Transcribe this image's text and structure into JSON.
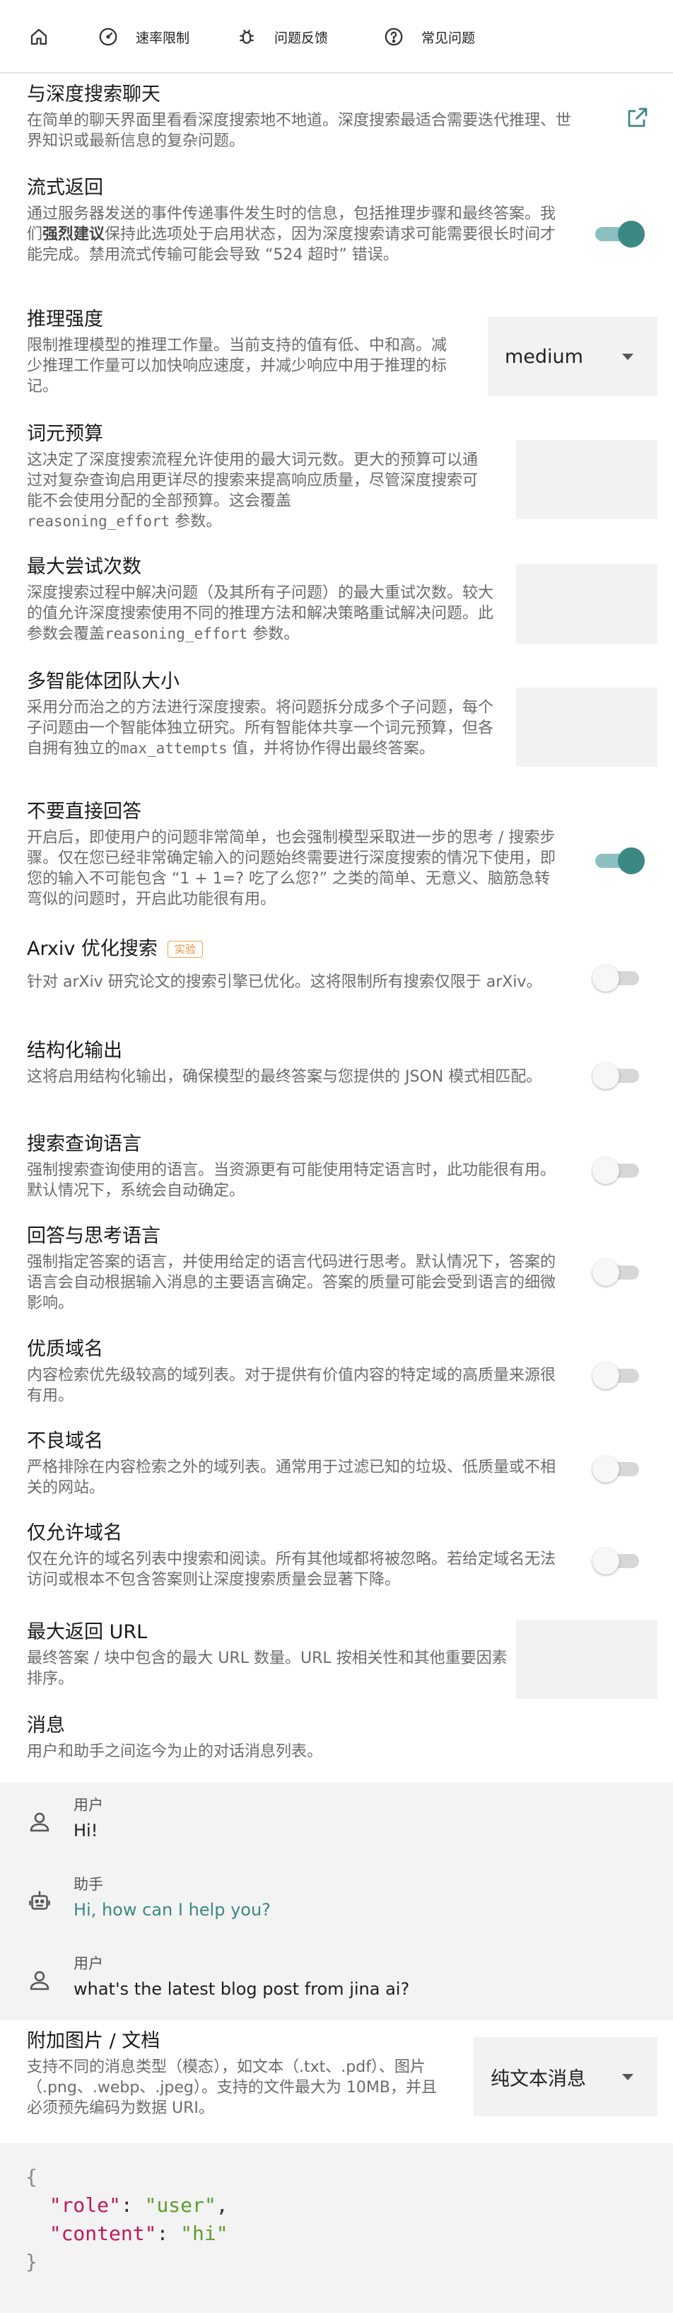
{
  "nav": {
    "home_icon": "home-icon",
    "items": [
      {
        "icon": "speedometer-icon",
        "label": "速率限制"
      },
      {
        "icon": "bug-icon",
        "label": "问题反馈"
      },
      {
        "icon": "help-circle-icon",
        "label": "常见问题"
      }
    ]
  },
  "chat": {
    "title": "与深度搜索聊天",
    "desc": "在简单的聊天界面里看看深度搜索地不地道。深度搜索最适合需要迭代推理、世界知识或最新信息的复杂问题。",
    "icon": "external-link-icon"
  },
  "stream": {
    "title": "流式返回",
    "desc_a": "通过服务器发送的事件传递事件发生时的信息，包括推理步骤和最终答案。我们",
    "desc_bold": "强烈建议",
    "desc_b": "保持此选项处于启用状态，因为深度搜索请求可能需要很长时间才能完成。禁用流式传输可能会导致 “524 超时” 错误。",
    "enabled": true
  },
  "reasoning": {
    "title": "推理强度",
    "desc": "限制推理模型的推理工作量。当前支持的值有低、中和高。减少推理工作量可以加快响应速度，并减少响应中用于推理的标记。",
    "value": "medium"
  },
  "budget": {
    "title": "词元预算",
    "desc": "这决定了深度搜索流程允许使用的最大词元数。更大的预算可以通过对复杂查询启用更详尽的搜索来提高响应质量，尽管深度搜索可能不会使用分配的全部预算。这会覆盖",
    "code": "reasoning_effort",
    "desc_end": " 参数。"
  },
  "attempts": {
    "title": "最大尝试次数",
    "desc": "深度搜索过程中解决问题（及其所有子问题）的最大重试次数。较大的值允许深度搜索使用不同的推理方法和解决策略重试解决问题。此参数会覆盖",
    "code": "reasoning_effort",
    "desc_end": " 参数。"
  },
  "team": {
    "title": "多智能体团队大小",
    "desc": "采用分而治之的方法进行深度搜索。将问题拆分成多个子问题，每个子问题由一个智能体独立研究。所有智能体共享一个词元预算，但各自拥有独立的",
    "code": "max_attempts",
    "desc_end": " 值，并将协作得出最终答案。"
  },
  "no_direct": {
    "title": "不要直接回答",
    "desc": "开启后，即使用户的问题非常简单，也会强制模型采取进一步的思考 / 搜索步骤。仅在您已经非常确定输入的问题始终需要进行深度搜索的情况下使用，即您的输入不可能包含 “1 + 1=? 吃了么您?” 之类的简单、无意义、脑筋急转弯似的问题时，开启此功能很有用。",
    "enabled": true
  },
  "arxiv": {
    "title": "Arxiv 优化搜索",
    "badge": "实验",
    "desc": "针对 arXiv 研究论文的搜索引擎已优化。这将限制所有搜索仅限于 arXiv。",
    "enabled": false
  },
  "structured": {
    "title": "结构化输出",
    "desc": "这将启用结构化输出，确保模型的最终答案与您提供的 JSON 模式相匹配。",
    "enabled": false
  },
  "search_lang": {
    "title": "搜索查询语言",
    "desc": "强制搜索查询使用的语言。当资源更有可能使用特定语言时，此功能很有用。默认情况下，系统会自动确定。",
    "enabled": false
  },
  "answer_lang": {
    "title": "回答与思考语言",
    "desc": "强制指定答案的语言，并使用给定的语言代码进行思考。默认情况下，答案的语言会自动根据输入消息的主要语言确定。答案的质量可能会受到语言的细微影响。",
    "enabled": false
  },
  "good_domains": {
    "title": "优质域名",
    "desc": "内容检索优先级较高的域列表。对于提供有价值内容的特定域的高质量来源很有用。",
    "enabled": false
  },
  "bad_domains": {
    "title": "不良域名",
    "desc": "严格排除在内容检索之外的域列表。通常用于过滤已知的垃圾、低质量或不相关的网站。",
    "enabled": false
  },
  "only_domains": {
    "title": "仅允许域名",
    "desc": "仅在允许的域名列表中搜索和阅读。所有其他域都将被忽略。若给定域名无法访问或根本不包含答案则让深度搜索质量会显著下降。",
    "enabled": false
  },
  "max_urls": {
    "title": "最大返回 URL",
    "desc": "最终答案 / 块中包含的最大 URL 数量。URL 按相关性和其他重要因素排序。"
  },
  "messages": {
    "title": "消息",
    "desc": "用户和助手之间迄今为止的对话消息列表。",
    "items": [
      {
        "icon": "user-icon",
        "role": "用户",
        "content": "Hi!"
      },
      {
        "icon": "robot-icon",
        "role": "助手",
        "content": "Hi, how can I help you?"
      },
      {
        "icon": "user-icon",
        "role": "用户",
        "content": "what's the latest blog post from jina ai?"
      }
    ]
  },
  "attach": {
    "title": "附加图片 / 文档",
    "desc": "支持不同的消息类型（模态），如文本（.txt、.pdf）、图片（.png、.webp、.jpeg）。支持的文件最大为 10MB，并且必须预先编码为数据 URI。",
    "value": "纯文本消息"
  },
  "code": {
    "open": "{",
    "role_key": "\"role\"",
    "role_val": "\"user\"",
    "content_key": "\"content\"",
    "content_val": "\"hi\"",
    "close": "}"
  },
  "colors": {
    "accent": "#3b8884",
    "badge": "#e8913a"
  }
}
